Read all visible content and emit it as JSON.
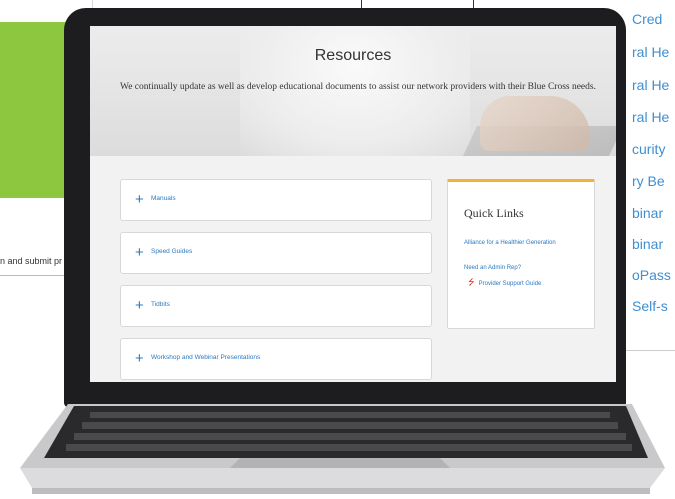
{
  "background": {
    "left_text": "n and submit pr",
    "right_list": [
      "Cred",
      "ral He",
      "ral He",
      "ral He",
      "curity",
      "ry Be",
      "binar",
      "binar",
      "oPass",
      "Self-s"
    ]
  },
  "hero": {
    "title": "Resources",
    "subtitle": "We continually update as well as develop educational documents to assist our network providers with their Blue Cross needs."
  },
  "accordions": [
    {
      "label": "Manuals"
    },
    {
      "label": "Speed Guides"
    },
    {
      "label": "Tidbits"
    },
    {
      "label": "Workshop and Webinar Presentations"
    }
  ],
  "quick_links": {
    "title": "Quick Links",
    "links": [
      {
        "label": "Alliance for a Healthier Generation"
      },
      {
        "label": "Need an Admin Rep?"
      },
      {
        "label": "Provider Support Guide",
        "icon": "pdf-icon"
      }
    ]
  },
  "colors": {
    "accent_blue": "#2c7ac0",
    "quick_links_bar": "#f2b234",
    "green_panel": "#8dc63f",
    "pdf_red": "#d9342b"
  }
}
